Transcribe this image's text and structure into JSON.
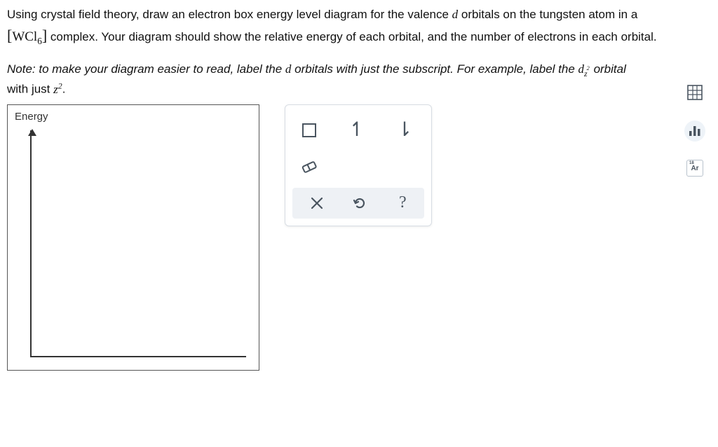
{
  "question": {
    "line1a": "Using crystal field theory, draw an electron box energy level diagram for the valence ",
    "d_letter": "d",
    "line1b": " orbitals on the tungsten atom in a",
    "complex_open": "[",
    "complex_formula_base": "WCl",
    "complex_formula_sub": "6",
    "complex_close": "]",
    "line2": " complex. Your diagram should show the relative energy of each orbital, and the number of electrons in each orbital."
  },
  "note": {
    "prefix": "Note:",
    "body1": " to make your diagram easier to read, label the ",
    "d_letter": "d",
    "body2": " orbitals with just the subscript. For example, label the ",
    "d_sub_base": "d",
    "d_sub_sub": "z",
    "d_sub_sup": "2",
    "body3": " orbital",
    "line3a": "with just ",
    "z2_base": "z",
    "z2_sup": "2",
    "line3b": "."
  },
  "canvas": {
    "axis_label": "Energy"
  },
  "palette": {
    "box_tool": "box",
    "up_arrow": "↿",
    "down_arrow": "⇂",
    "eraser": "eraser",
    "clear": "✕",
    "undo": "↺",
    "help": "?"
  },
  "side": {
    "table_icon": "table",
    "chart_icon": "chart",
    "periodic": "Ar"
  }
}
